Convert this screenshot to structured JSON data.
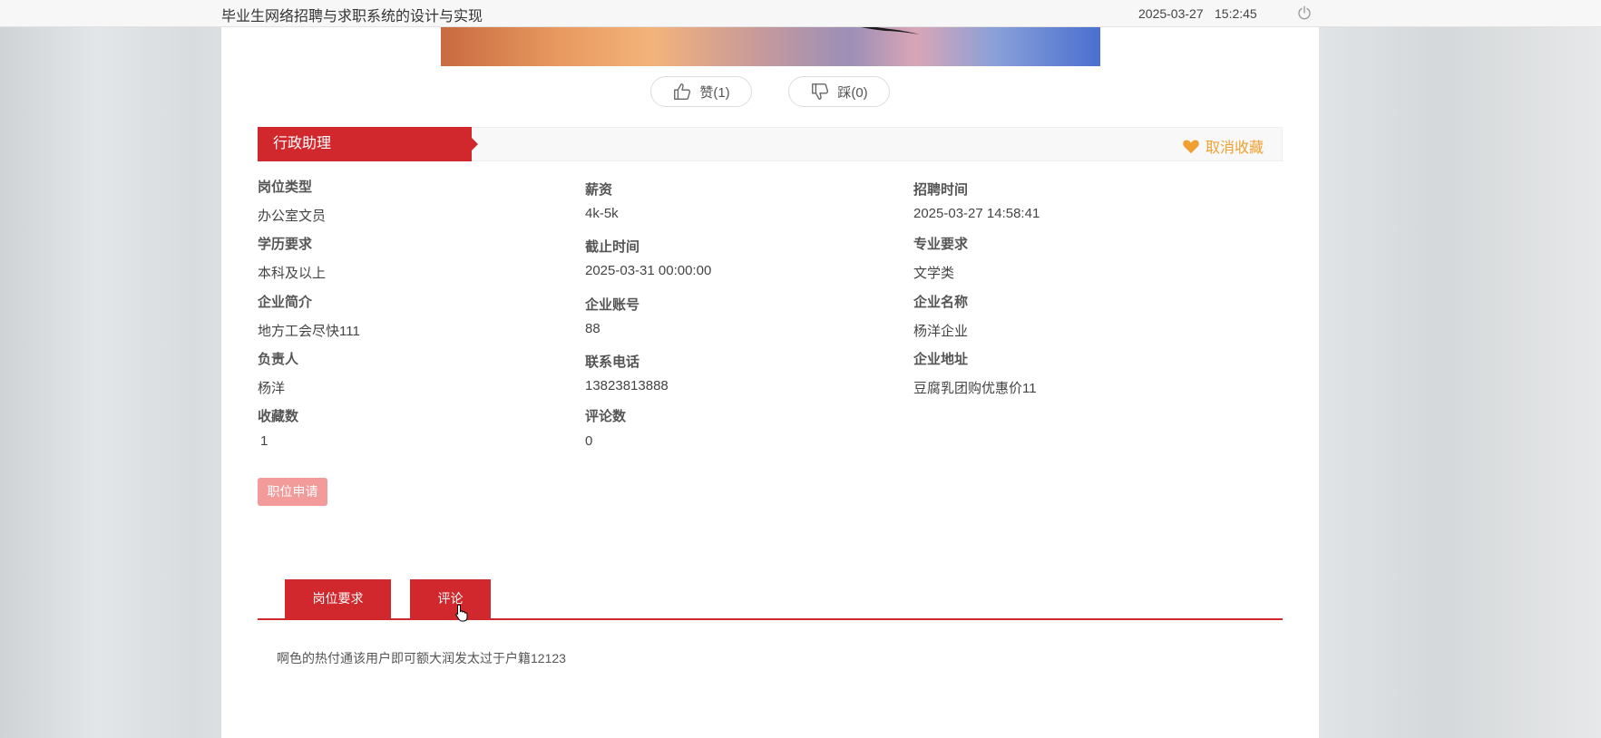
{
  "topbar": {
    "site_title": "毕业生网络招聘与求职系统的设计与实现",
    "date": "2025-03-27",
    "time": "15:2:45",
    "power_icon": "power-icon"
  },
  "votes": {
    "like_label": "赞(1)",
    "dislike_label": "踩(0)"
  },
  "job": {
    "title": "行政助理",
    "favorite_label": "取消收藏"
  },
  "fields": [
    {
      "label": "岗位类型",
      "value": "办公室文员"
    },
    {
      "label": "薪资",
      "value": "4k-5k"
    },
    {
      "label": "招聘时间",
      "value": "2025-03-27 14:58:41"
    },
    {
      "label": "学历要求",
      "value": "本科及以上"
    },
    {
      "label": "截止时间",
      "value": "2025-03-31 00:00:00"
    },
    {
      "label": "专业要求",
      "value": "文学类"
    },
    {
      "label": "企业简介",
      "value": "地方工会尽快111"
    },
    {
      "label": "企业账号",
      "value": "88"
    },
    {
      "label": "企业名称",
      "value": "杨洋企业"
    },
    {
      "label": "负责人",
      "value": "杨洋"
    },
    {
      "label": "联系电话",
      "value": "13823813888"
    },
    {
      "label": "企业地址",
      "value": "豆腐乳团购优惠价11"
    },
    {
      "label": "收藏数",
      "value": "1"
    },
    {
      "label": "评论数",
      "value": "0"
    }
  ],
  "apply_label": "职位申请",
  "tabs": [
    {
      "label": "岗位要求"
    },
    {
      "label": "评论"
    }
  ],
  "tab_content": "啊色的热付通该用户即可额大润发太过于户籍12123",
  "colors": {
    "accent": "#d0282c",
    "favorite": "#f0a030",
    "apply": "#f39a9a"
  }
}
